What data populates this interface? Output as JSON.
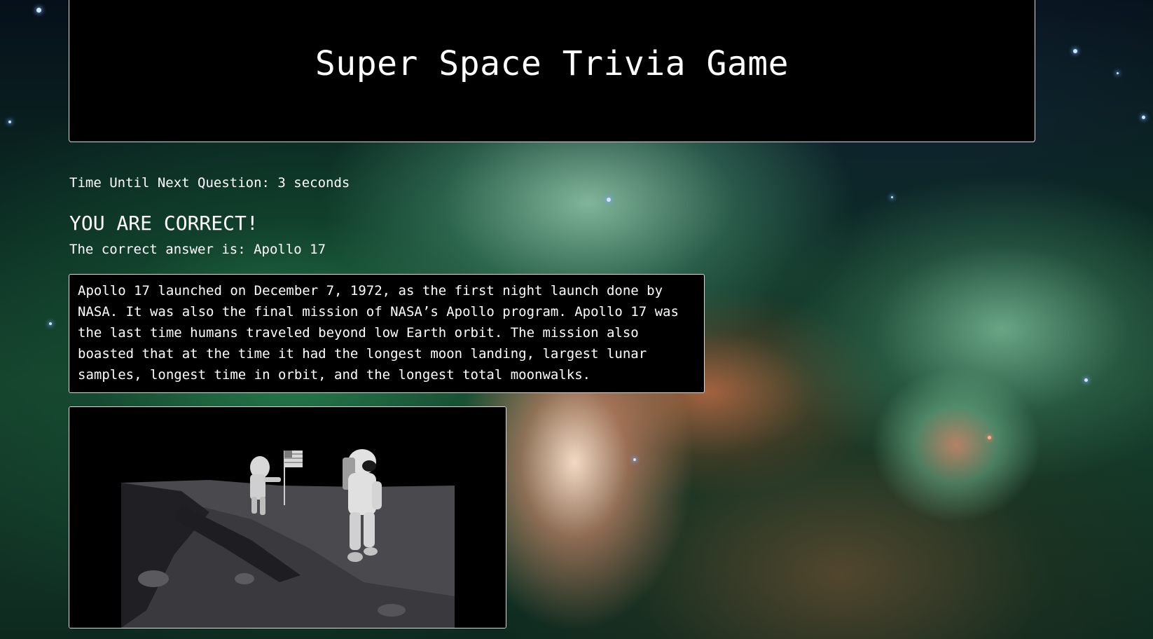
{
  "header": {
    "title": "Super Space Trivia Game"
  },
  "timer": {
    "text": "Time Until Next Question: 3 seconds"
  },
  "result": {
    "heading": "YOU ARE CORRECT!",
    "answer_text": "The correct answer is: Apollo 17"
  },
  "fact": {
    "text": "Apollo 17 launched on December 7, 1972, as the first night launch done by NASA. It was also the final mission of NASA’s Apollo program. Apollo 17 was the last time humans traveled beyond low Earth orbit. The mission also boasted that at the time it had the longest moon landing, largest lunar samples, longest time in orbit, and the longest total moonwalks."
  },
  "photo": {
    "subject": "astronauts-on-moon-with-flag"
  }
}
